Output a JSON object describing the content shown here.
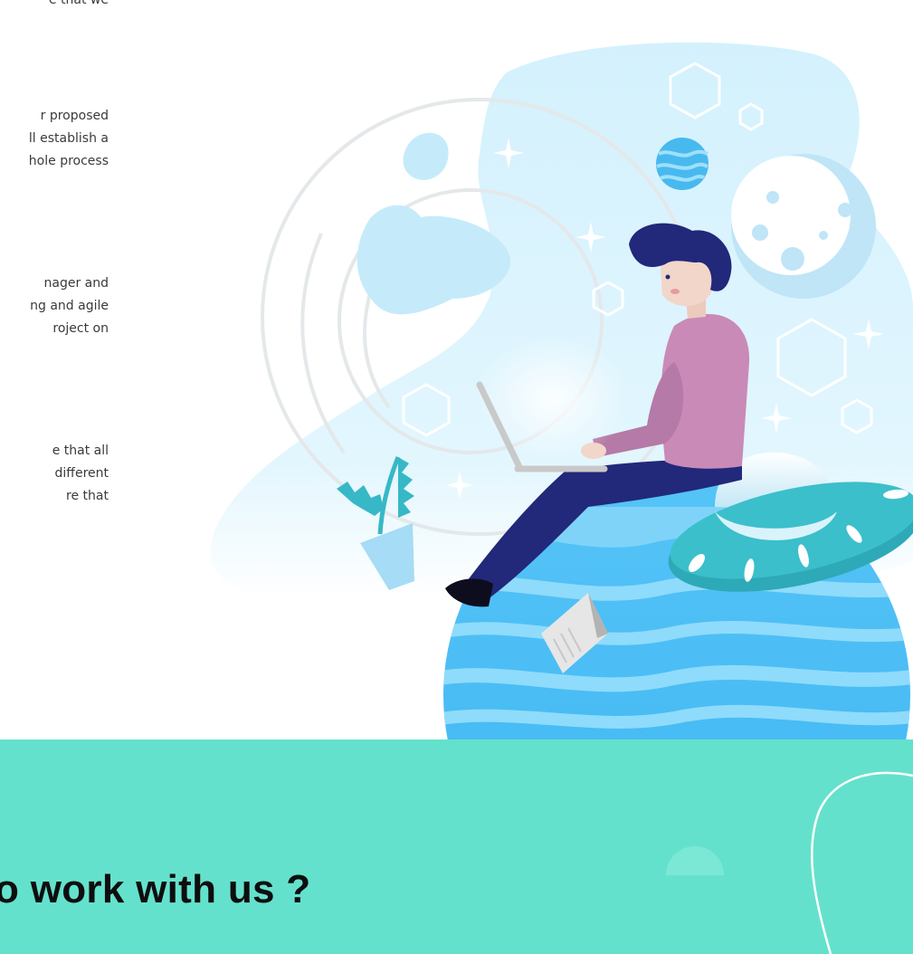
{
  "paragraphs": [
    "e that we",
    "r proposed\nll establish a\nhole process",
    "nager and\nng and agile\nroject on",
    "e that all\ndifferent\nre that"
  ],
  "section_title": "o work with us ?",
  "colors": {
    "teal_band": "#64e1cc",
    "sky_light": "#d3f1fd",
    "planet_blue": "#49c0f8",
    "shirt_pink": "#c98ab8",
    "pants_navy": "#22287a",
    "ufo_teal": "#3bbfcb"
  },
  "icons": {
    "plant": "potted-plant-icon",
    "ufo": "ufo-icon",
    "moon": "moon-icon",
    "planet": "planet-icon"
  }
}
